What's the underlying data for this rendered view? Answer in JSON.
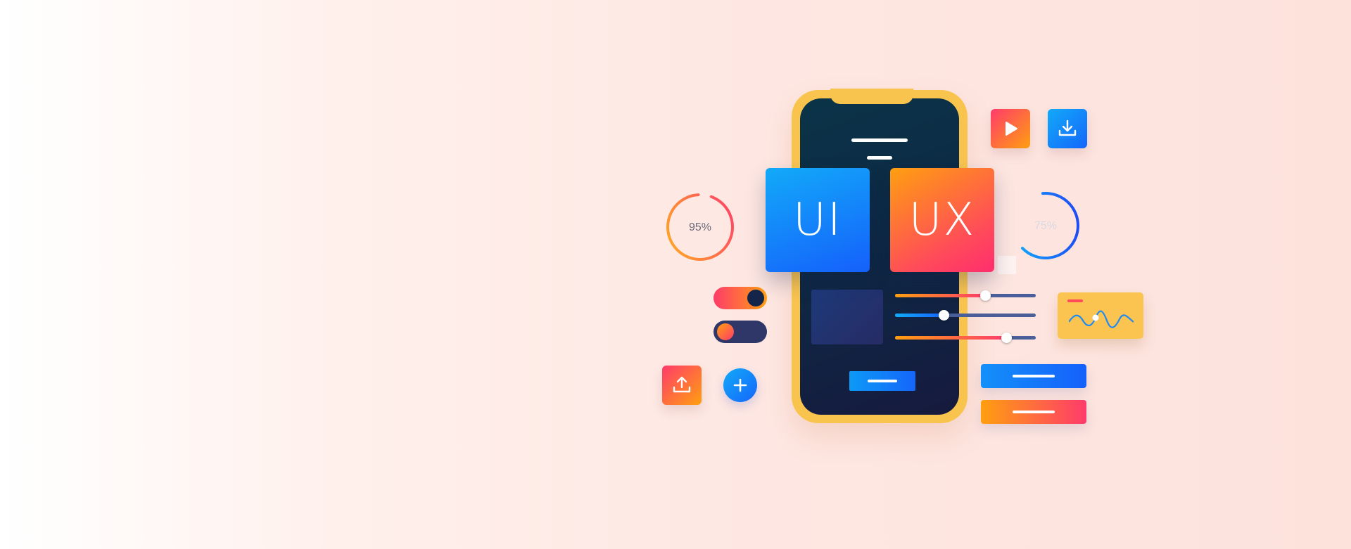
{
  "tiles": {
    "ui_label": "UI",
    "ux_label": "UX"
  },
  "gauges": [
    {
      "label": "95%",
      "value": 95
    },
    {
      "label": "75%",
      "value": 75
    }
  ],
  "sliders": [
    {
      "value": 0.64
    },
    {
      "value": 0.34
    },
    {
      "value": 0.79
    }
  ],
  "toggles": [
    {
      "state": "on"
    },
    {
      "state": "off"
    }
  ],
  "icons": {
    "play": "play-icon",
    "download": "download-icon",
    "upload": "upload-icon",
    "add": "plus-icon"
  },
  "colors": {
    "phone_frame": "#f9c44e",
    "screen_bg": "#0d2a45",
    "blue": "#1566fa",
    "orange": "#ff9f10",
    "pink": "#ff3b6b"
  }
}
